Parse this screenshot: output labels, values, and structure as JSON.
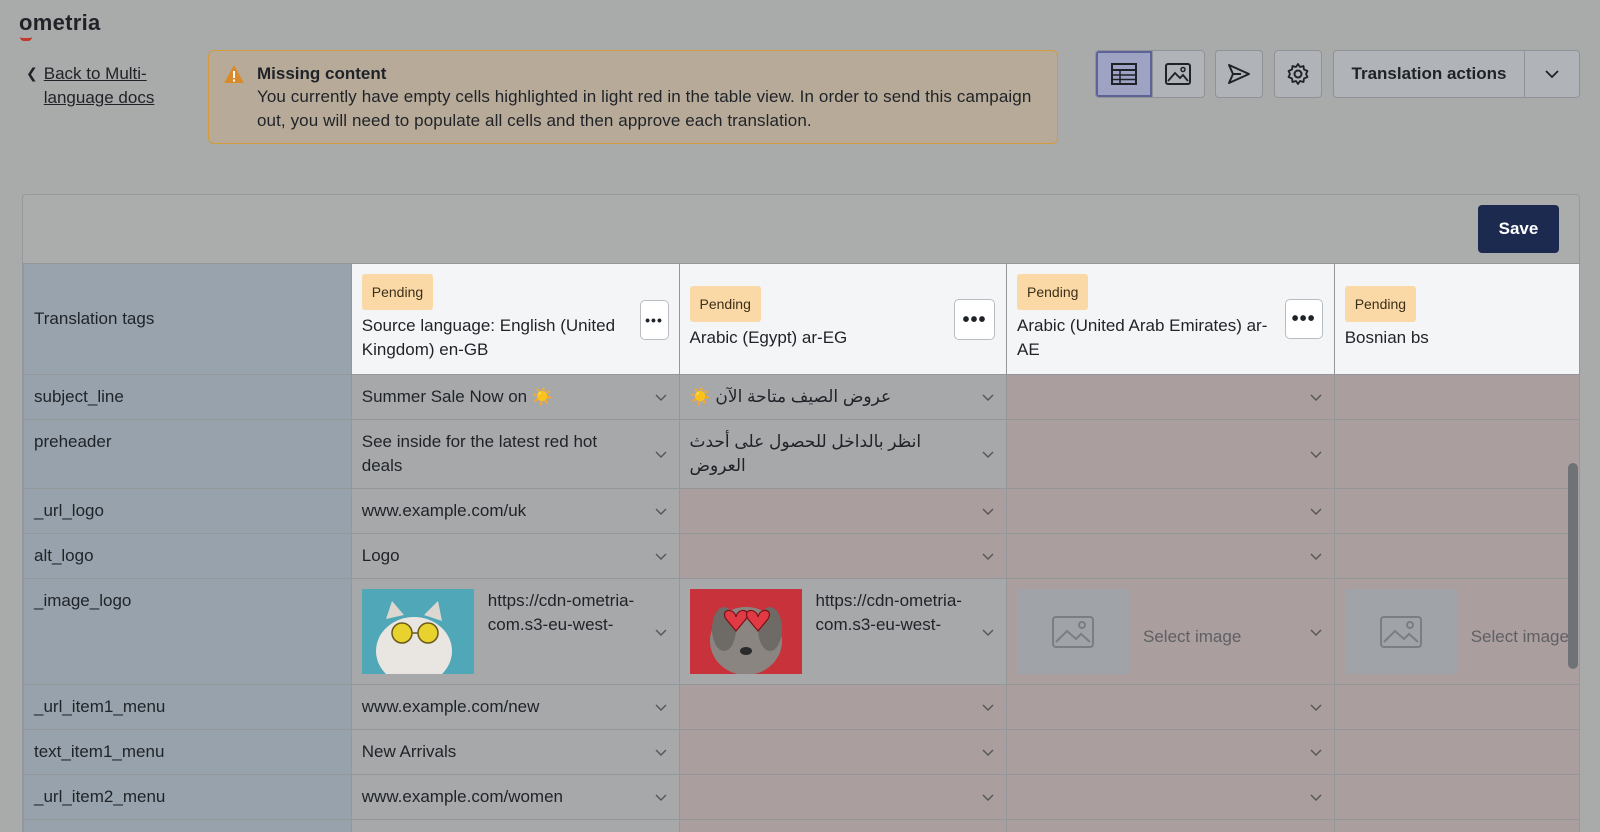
{
  "brand": {
    "logo_text": "ometria"
  },
  "back_link": {
    "label": "Back to Multi-language docs"
  },
  "alert": {
    "title": "Missing content",
    "message": "You currently have empty cells highlighted in light red in the table view. In order to send this campaign out, you will need to populate all cells and then approve each translation."
  },
  "toolbar": {
    "view_table_icon": "table-view-icon",
    "view_image_icon": "image-view-icon",
    "send_icon": "send-icon",
    "settings_icon": "gear-icon",
    "actions_label": "Translation actions"
  },
  "save_label": "Save",
  "table": {
    "tags_header": "Translation tags",
    "languages": [
      {
        "status": "Pending",
        "name": "Source language: English (United Kingdom) en-GB"
      },
      {
        "status": "Pending",
        "name": "Arabic (Egypt) ar-EG"
      },
      {
        "status": "Pending",
        "name": "Arabic (United Arab Emirates) ar-AE"
      },
      {
        "status": "Pending",
        "name": "Bosnian bs"
      }
    ],
    "kebab_label": "•••",
    "rows": [
      {
        "tag": "subject_line",
        "en": "Summer Sale Now on ☀️",
        "ar": "عروض الصيف متاحة الآن ☀️"
      },
      {
        "tag": "preheader",
        "en": "See inside for the latest red hot deals",
        "ar": "انظر بالداخل للحصول على أحدث العروض"
      },
      {
        "tag": "_url_logo",
        "en": "www.example.com/uk",
        "ar": ""
      },
      {
        "tag": "alt_logo",
        "en": "Logo",
        "ar": ""
      },
      {
        "tag": "_image_logo",
        "en": "https://cdn-ometria-com.s3-eu-west-",
        "ar": "https://cdn-ometria-com.s3-eu-west-",
        "select_image": "Select image"
      },
      {
        "tag": "_url_item1_menu",
        "en": "www.example.com/new",
        "ar": ""
      },
      {
        "tag": "text_item1_menu",
        "en": "New Arrivals",
        "ar": ""
      },
      {
        "tag": "_url_item2_menu",
        "en": "www.example.com/women",
        "ar": ""
      }
    ]
  },
  "colors": {
    "accent": "#1c2a4f",
    "pending": "#fbd9a6",
    "empty_cell": "#ab9e9f",
    "warning_border": "#d39b3c"
  }
}
